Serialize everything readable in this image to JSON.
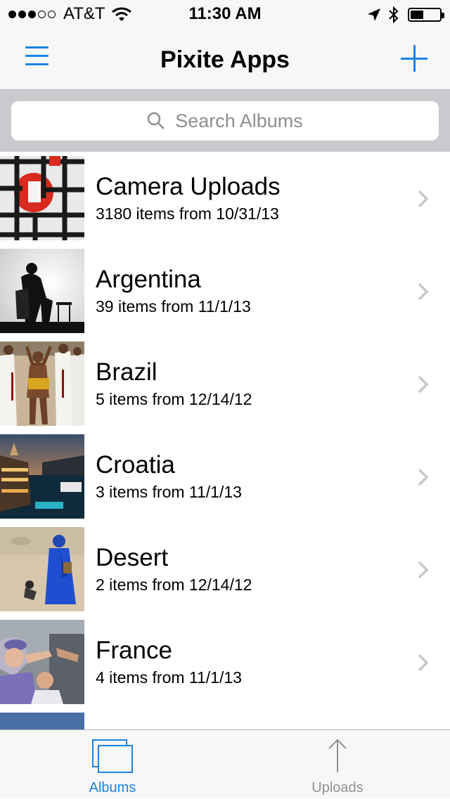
{
  "status": {
    "carrier": "AT&T",
    "time": "11:30 AM",
    "signal_bars": 3,
    "signal_total": 5
  },
  "nav": {
    "title": "Pixite Apps"
  },
  "search": {
    "placeholder": "Search Albums"
  },
  "albums": [
    {
      "title": "Camera Uploads",
      "subtitle": "3180 items from 10/31/13"
    },
    {
      "title": "Argentina",
      "subtitle": "39 items from 11/1/13"
    },
    {
      "title": "Brazil",
      "subtitle": "5 items from 12/14/12"
    },
    {
      "title": "Croatia",
      "subtitle": "3 items from 11/1/13"
    },
    {
      "title": "Desert",
      "subtitle": "2 items from 12/14/12"
    },
    {
      "title": "France",
      "subtitle": "4 items from 11/1/13"
    }
  ],
  "tabs": [
    {
      "label": "Albums",
      "active": true,
      "icon": "albums-icon"
    },
    {
      "label": "Uploads",
      "active": false,
      "icon": "upload-arrow-icon"
    }
  ],
  "colors": {
    "accent": "#1a83e3",
    "inactive": "#929292"
  }
}
